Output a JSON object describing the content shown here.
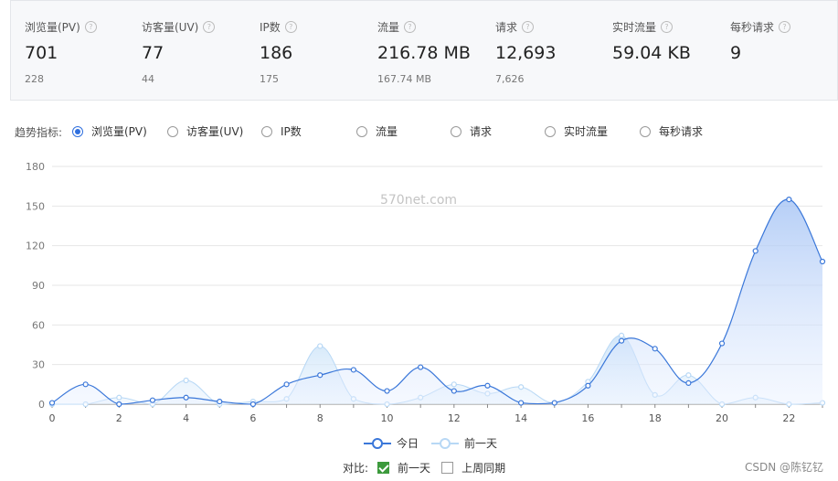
{
  "stats": [
    {
      "label": "浏览量(PV)",
      "value": "701",
      "prev": "228"
    },
    {
      "label": "访客量(UV)",
      "value": "77",
      "prev": "44"
    },
    {
      "label": "IP数",
      "value": "186",
      "prev": "175"
    },
    {
      "label": "流量",
      "value": "216.78 MB",
      "prev": "167.74 MB"
    },
    {
      "label": "请求",
      "value": "12,693",
      "prev": "7,626"
    },
    {
      "label": "实时流量",
      "value": "59.04 KB",
      "prev": ""
    },
    {
      "label": "每秒请求",
      "value": "9",
      "prev": ""
    }
  ],
  "help_icon_glyph": "?",
  "trend": {
    "label": "趋势指标:",
    "options": [
      "浏览量(PV)",
      "访客量(UV)",
      "IP数",
      "流量",
      "请求",
      "实时流量",
      "每秒请求"
    ],
    "selected": "浏览量(PV)"
  },
  "watermark": "570net.com",
  "legend": {
    "today": "今日",
    "prev": "前一天"
  },
  "compare": {
    "label": "对比:",
    "prev_day": "前一天",
    "prev_day_checked": true,
    "last_week": "上周同期",
    "last_week_checked": false
  },
  "credit": "CSDN @陈钇钇",
  "colors": {
    "today": "#3a77d9",
    "prev": "#b8d8f5",
    "accent": "#2f6fde",
    "check": "#3c9a3c"
  },
  "chart_data": {
    "type": "area",
    "x": [
      0,
      1,
      2,
      3,
      4,
      5,
      6,
      7,
      8,
      9,
      10,
      11,
      12,
      13,
      14,
      15,
      16,
      17,
      18,
      19,
      20,
      21,
      22,
      23
    ],
    "xticks": [
      0,
      2,
      4,
      6,
      8,
      10,
      12,
      14,
      16,
      18,
      20,
      22
    ],
    "ylim": [
      0,
      180
    ],
    "yticks": [
      0,
      30,
      60,
      90,
      120,
      150,
      180
    ],
    "grid": true,
    "legend_position": "bottom",
    "series": [
      {
        "name": "今日",
        "values": [
          1,
          15,
          0,
          3,
          5,
          2,
          0,
          15,
          22,
          26,
          10,
          28,
          10,
          14,
          1,
          1,
          14,
          48,
          42,
          16,
          46,
          116,
          155,
          108
        ]
      },
      {
        "name": "前一天",
        "values": [
          0,
          0,
          5,
          0,
          18,
          0,
          2,
          4,
          44,
          4,
          0,
          5,
          15,
          8,
          13,
          1,
          17,
          52,
          7,
          22,
          0,
          5,
          0,
          1
        ]
      }
    ]
  }
}
